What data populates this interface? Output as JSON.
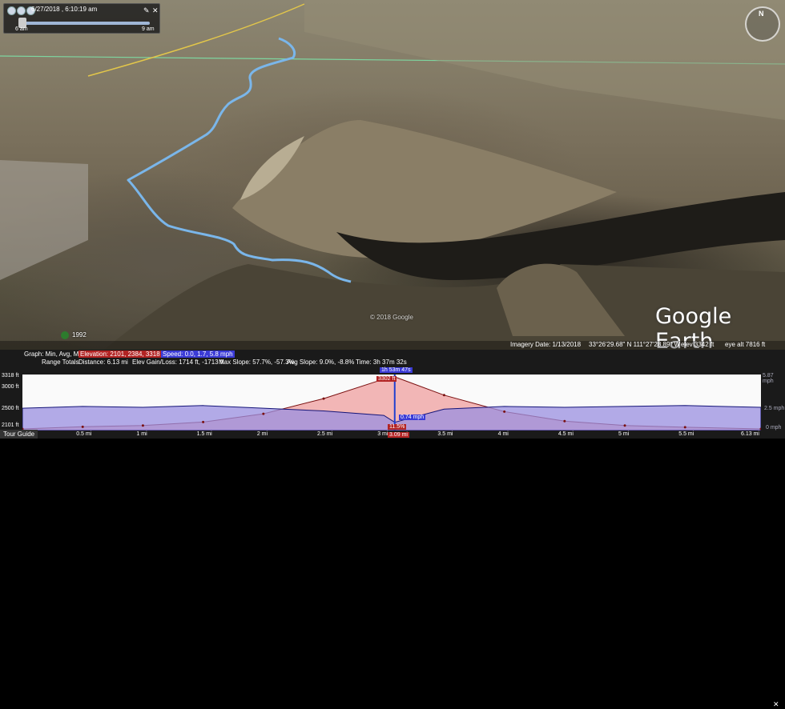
{
  "time_slider": {
    "date_label": "6/27/2018 , 6:10:19 am",
    "start_label": "6 am",
    "end_label": "9 am",
    "tools": [
      "wrench-icon",
      "close-icon"
    ]
  },
  "compass": {
    "north_label": "N"
  },
  "map": {
    "year_label": "1992",
    "copyright": "© 2018 Google",
    "logo": "Google Earth"
  },
  "status": {
    "imagery_date": "Imagery Date: 1/13/2018",
    "coords": "33°26'29.68\" N  111°27'28.89\" W",
    "elev": "elev  3342 ft",
    "eye_alt": "eye alt   7816 ft"
  },
  "elevation_panel": {
    "graph_label": "Graph: Min, Avg, Max",
    "elevation": "Elevation: 2101, 2384, 3318 ft",
    "speed": "Speed: 0.0, 1.7, 5.8 mph",
    "range_label": "Range Totals",
    "distance": "Distance: 6.13 mi",
    "elev_gain": "Elev Gain/Loss: 1714 ft, -1713 ft",
    "max_slope": "Max Slope: 57.7%, -57.3%",
    "avg_slope": "Avg Slope: 9.0%, -8.8%",
    "time": "Time: 3h 37m 32s",
    "tour_guide": "Tour Guide",
    "y_left": [
      "3318 ft",
      "3000 ft",
      "2500 ft",
      "2101 ft"
    ],
    "y_right": [
      "5.87 mph",
      "2.5 mph",
      "0 mph"
    ],
    "x_ticks": [
      "0.5 mi",
      "1 mi",
      "1.5 mi",
      "2 mi",
      "2.5 mi",
      "3 mi",
      "3.5 mi",
      "4 mi",
      "4.5 mi",
      "5 mi",
      "5.5 mi",
      "6.13 mi"
    ],
    "cursor_time": "1h 53m 47s",
    "cursor_elev": "3302 ft",
    "cursor_speed": "0.74 mph",
    "cursor_slope": "11.5%",
    "cursor_dist": "3.09 mi",
    "colors": {
      "elevation_fill": "#f2b6b6",
      "speed_fill": "#9a8fe0",
      "speed_line": "#141478",
      "elev_line": "#7a1010"
    }
  },
  "chart_data": {
    "type": "area",
    "x": [
      0,
      0.5,
      1,
      1.5,
      2,
      2.5,
      3,
      3.09,
      3.5,
      4,
      4.5,
      5,
      5.5,
      6.13
    ],
    "series": [
      {
        "name": "Elevation",
        "values": [
          2101,
          2150,
          2180,
          2260,
          2450,
          2800,
          3250,
          3302,
          2880,
          2500,
          2280,
          2180,
          2140,
          2101
        ]
      },
      {
        "name": "Speed",
        "values": [
          2.3,
          2.5,
          2.4,
          2.6,
          2.3,
          2.0,
          1.5,
          0.74,
          2.2,
          2.5,
          2.4,
          2.5,
          2.6,
          2.4
        ]
      }
    ],
    "xlabel": "",
    "ylabel": "",
    "ylim": [
      2101,
      3318
    ],
    "y2lim": [
      0,
      5.87
    ],
    "xlim": [
      0,
      6.13
    ]
  }
}
